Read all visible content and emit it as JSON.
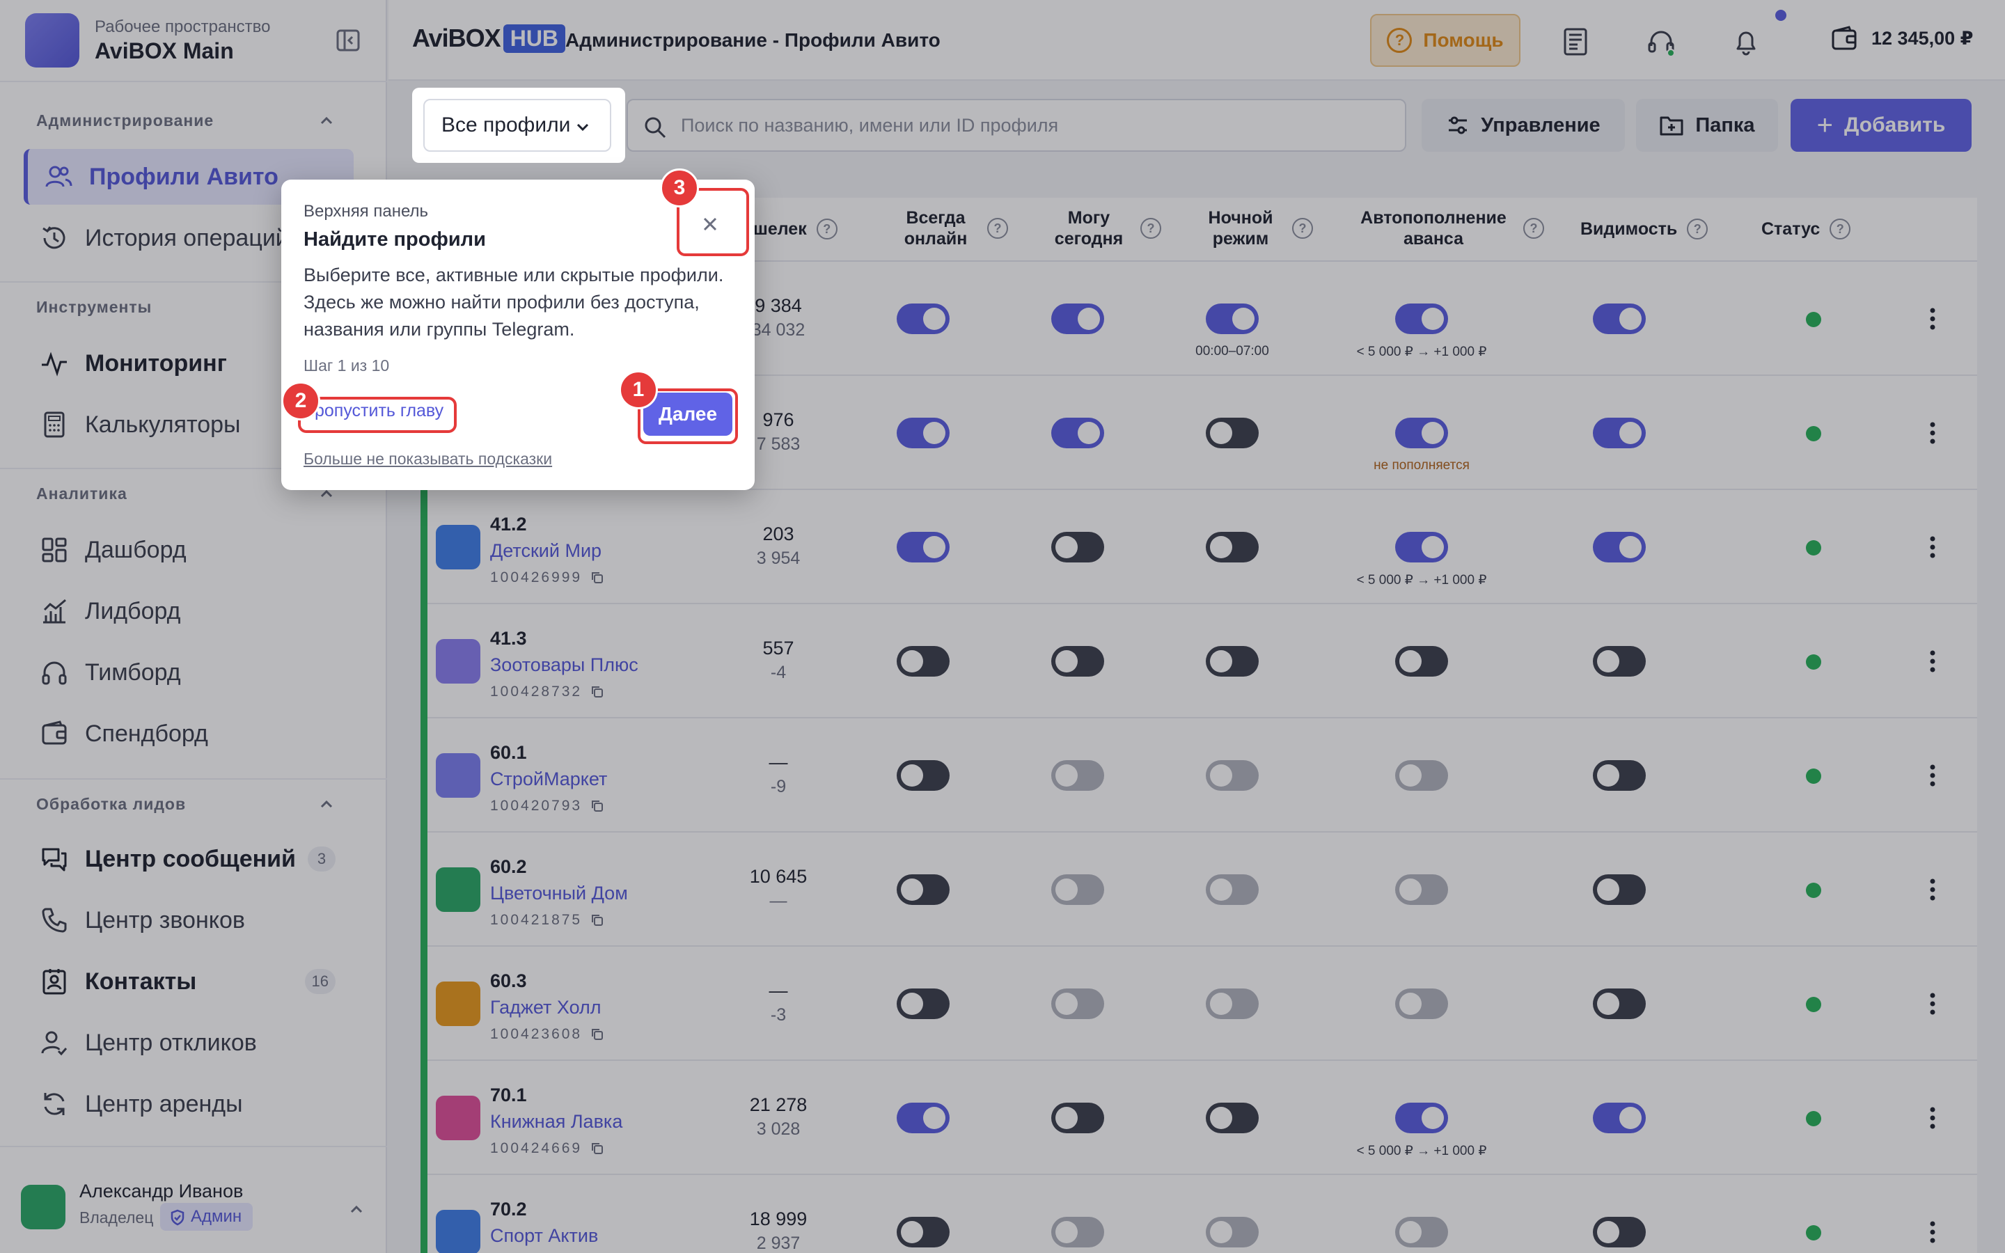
{
  "workspace": {
    "label": "Рабочее пространство",
    "name": "AviBOX Main"
  },
  "sidebar": {
    "sections": [
      {
        "title": "Администрирование"
      },
      {
        "title": "Инструменты"
      },
      {
        "title": "Аналитика"
      },
      {
        "title": "Обработка лидов"
      }
    ],
    "items": [
      {
        "label": "Профили Авито",
        "icon": "users-icon"
      },
      {
        "label": "История операций",
        "icon": "history-icon"
      },
      {
        "label": "Мониторинг",
        "icon": "activity-icon"
      },
      {
        "label": "Калькуляторы",
        "icon": "calculator-icon"
      },
      {
        "label": "Дашборд",
        "icon": "dashboard-icon"
      },
      {
        "label": "Лидборд",
        "icon": "chart-icon"
      },
      {
        "label": "Тимборд",
        "icon": "headphones-icon"
      },
      {
        "label": "Спендборд",
        "icon": "wallet-icon"
      },
      {
        "label": "Центр сообщений",
        "icon": "messages-icon",
        "badge": "3"
      },
      {
        "label": "Центр звонков",
        "icon": "phone-icon"
      },
      {
        "label": "Контакты",
        "icon": "contacts-icon",
        "badge": "16"
      },
      {
        "label": "Центр откликов",
        "icon": "user-response-icon"
      },
      {
        "label": "Центр аренды",
        "icon": "refresh-icon"
      }
    ]
  },
  "user": {
    "name": "Александр Иванов",
    "role": "Владелец",
    "admin": "Админ"
  },
  "header": {
    "logo_main": "AviBOX",
    "logo_hub": "HUB",
    "title": "Администрирование - Профили Авито",
    "help": "Помощь",
    "balance": "12 345,00 ₽"
  },
  "toolbar": {
    "filter": "Все профили",
    "search_placeholder": "Поиск по названию, имени или ID профиля",
    "manage": "Управление",
    "folder": "Папка",
    "add": "Добавить"
  },
  "table": {
    "headers": [
      "шелек",
      "Всегда онлайн",
      "Могу сегодня",
      "Ночной режим",
      "Автопополнение аванса",
      "Видимость",
      "Статус"
    ],
    "rows": [
      {
        "num": "",
        "name": "",
        "pid": "",
        "v1": "9 384",
        "v2": "34 032",
        "color": "#7b7ef0",
        "tg": [
          "on",
          "on",
          "on",
          "on",
          "on"
        ],
        "night": "00:00–07:00",
        "auto": "< 5 000 ₽ → +1 000 ₽"
      },
      {
        "num": "",
        "name": "",
        "pid": "",
        "v1": "976",
        "v2": "7 583",
        "color": "#7b7ef0",
        "tg": [
          "on",
          "on",
          "off",
          "on",
          "on"
        ],
        "night": "",
        "auto": "не пополняется"
      },
      {
        "num": "41.2",
        "name": "Детский Мир",
        "pid": "100426999",
        "v1": "203",
        "v2": "3 954",
        "color": "#3f7ee8",
        "tg": [
          "on",
          "off",
          "off",
          "on",
          "on"
        ],
        "night": "",
        "auto": "< 5 000 ₽ → +1 000 ₽"
      },
      {
        "num": "41.3",
        "name": "Зоотовары Плюс",
        "pid": "100428732",
        "v1": "557",
        "v2": "-4",
        "color": "#8a7ef0",
        "tg": [
          "off",
          "off",
          "off",
          "off",
          "off"
        ],
        "night": "",
        "auto": ""
      },
      {
        "num": "60.1",
        "name": "СтройМаркет",
        "pid": "100420793",
        "v1": "—",
        "v2": "-9",
        "color": "#7b7ef0",
        "tg": [
          "off",
          "dis",
          "dis",
          "dis",
          "off"
        ],
        "night": "",
        "auto": ""
      },
      {
        "num": "60.2",
        "name": "Цветочный Дом",
        "pid": "100421875",
        "v1": "10 645",
        "v2": "—",
        "color": "#2aa866",
        "tg": [
          "off",
          "dis",
          "dis",
          "dis",
          "off"
        ],
        "night": "",
        "auto": ""
      },
      {
        "num": "60.3",
        "name": "Гаджет Холл",
        "pid": "100423608",
        "v1": "—",
        "v2": "-3",
        "color": "#e89a1e",
        "tg": [
          "off",
          "dis",
          "dis",
          "dis",
          "off"
        ],
        "night": "",
        "auto": ""
      },
      {
        "num": "70.1",
        "name": "Книжная Лавка",
        "pid": "100424669",
        "v1": "21 278",
        "v2": "3 028",
        "color": "#e0509a",
        "tg": [
          "on",
          "off",
          "off",
          "on",
          "on"
        ],
        "night": "",
        "auto": "< 5 000 ₽ → +1 000 ₽"
      },
      {
        "num": "70.2",
        "name": "Спорт Актив",
        "pid": "",
        "v1": "18 999",
        "v2": "2 937",
        "color": "#3f7ee8",
        "tg": [
          "off",
          "dis",
          "dis",
          "dis",
          "off"
        ],
        "night": "",
        "auto": ""
      }
    ]
  },
  "tour": {
    "caption": "Верхняя панель",
    "title": "Найдите профили",
    "description": "Выберите все, активные или скрытые профили. Здесь же можно найти профили без доступа, названия или группы Telegram.",
    "step": "Шаг 1 из 10",
    "skip": "Пропустить главу",
    "next": "Далее",
    "no_hints": "Больше не показывать подсказки",
    "markers": [
      "1",
      "2",
      "3"
    ]
  },
  "colors": {
    "accent": "#5a5ee0",
    "status_ok": "#27b15a",
    "marker": "#e53a3a",
    "help": "#e08a16"
  }
}
